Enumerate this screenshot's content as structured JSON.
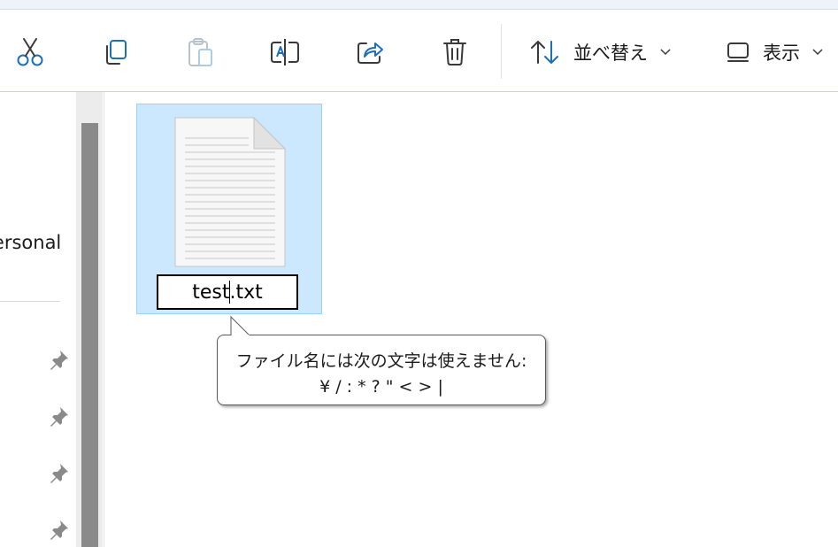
{
  "toolbar": {
    "buttons": [
      {
        "icon": "scissors-icon",
        "name": "cut-button"
      },
      {
        "icon": "copy-icon",
        "name": "copy-button"
      },
      {
        "icon": "paste-icon",
        "name": "paste-button"
      },
      {
        "icon": "rename-icon",
        "name": "rename-button"
      },
      {
        "icon": "share-icon",
        "name": "share-button"
      },
      {
        "icon": "trash-icon",
        "name": "delete-button"
      }
    ],
    "sort_label": "並べ替え",
    "view_label": "表示",
    "accent_color": "#0067c0"
  },
  "nav": {
    "personal_label": "Personal"
  },
  "file": {
    "name_before_caret": "test",
    "name_after_caret": ".txt",
    "selected": true
  },
  "tooltip": {
    "line1": "ファイル名には次の文字は使えません:",
    "line2": "¥ / : * ? \" < > |"
  }
}
